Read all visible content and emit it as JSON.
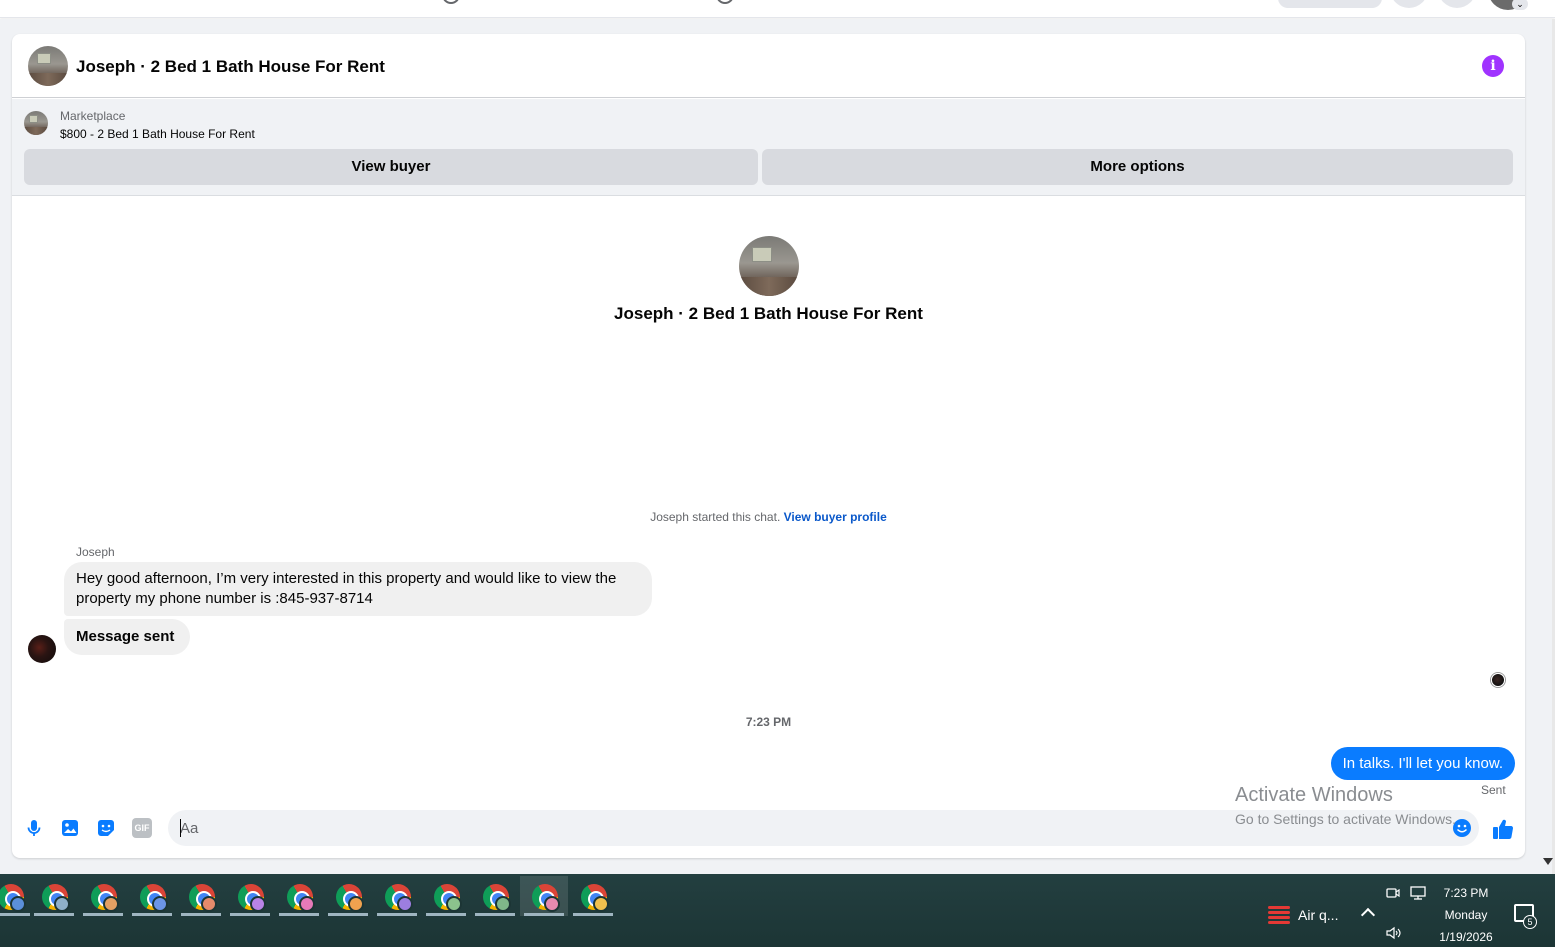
{
  "conversation": {
    "title": "Joseph · 2 Bed 1 Bath House For Rent",
    "info_icon": "info-icon"
  },
  "marketplace": {
    "label": "Marketplace",
    "listing": "$800 - 2 Bed 1 Bath House For Rent",
    "view_buyer": "View buyer",
    "more_options": "More options"
  },
  "intro": {
    "title": "Joseph · 2 Bed 1 Bath House For Rent",
    "started_text": "Joseph started this chat.",
    "profile_link": "View buyer profile"
  },
  "messages": [
    {
      "sender": "Joseph",
      "text": "Hey good afternoon, I’m very interested in this property and would like to view the property my phone number is :845-937-8714"
    },
    {
      "sender": "Joseph",
      "text": "Message sent"
    },
    {
      "sender": "me",
      "text": "In talks. I'll let you know.",
      "status": "Sent"
    }
  ],
  "timestamp": "7:23 PM",
  "composer": {
    "placeholder": "Aa",
    "icons": [
      "microphone-icon",
      "photo-icon",
      "sticker-icon",
      "gif-icon",
      "emoji-icon",
      "thumbs-up-icon"
    ],
    "gif_label": "GIF"
  },
  "watermark": {
    "line1": "Activate Windows",
    "line2": "Go to Settings to activate Windows."
  },
  "taskbar": {
    "weather_text": "Air q...",
    "time": "7:23 PM",
    "day": "Monday",
    "date": "1/19/2026",
    "notification_count": "5"
  },
  "colors": {
    "accent": "#0a7cff",
    "link": "#0a58ca",
    "info": "#a033ff",
    "taskbar": "#1f3b3b"
  }
}
